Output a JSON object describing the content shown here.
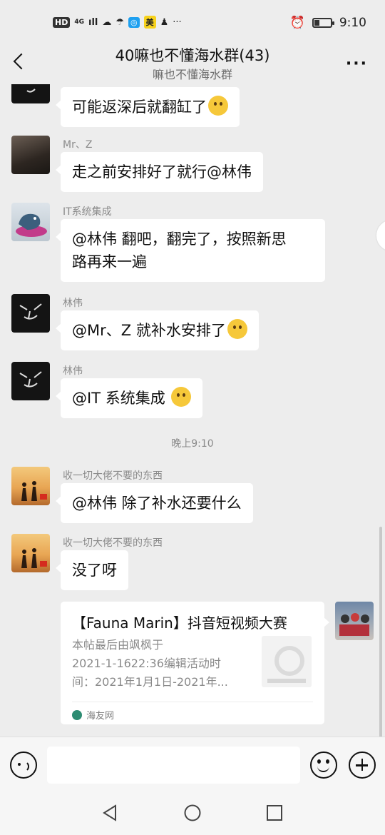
{
  "status_bar": {
    "hd": "HD",
    "network": "4G",
    "signal": "ıll",
    "icons": [
      "hd-icon",
      "signal-icon",
      "cloud-icon",
      "weather-icon",
      "qq-icon",
      "meituan-icon",
      "snap-icon",
      "more-dots-icon"
    ],
    "meituan_label": "美",
    "time": "9:10"
  },
  "header": {
    "title": "40嘛也不懂海水群(43)",
    "subtitle": "嘛也不懂海水群"
  },
  "messages": [
    {
      "sender": "",
      "text": "可能返深后就翻缸了",
      "emoji": "smirk-emoji"
    },
    {
      "sender": "Mr、Z",
      "text": "走之前安排好了就行@林伟"
    },
    {
      "sender": "IT系统集成",
      "text_line1": "@林伟  翻吧，翻完了，按照新思",
      "text_line2": "路再来一遍"
    },
    {
      "sender": "林伟",
      "text": "@Mr、Z  就补水安排了",
      "emoji": "laugh-cry-emoji"
    },
    {
      "sender": "林伟",
      "text": "@IT 系统集成 ",
      "emoji": "crying-emoji"
    },
    {
      "sender": "收一切大佬不要的东西",
      "text": "@林伟  除了补水还要什么"
    },
    {
      "sender": "收一切大佬不要的东西",
      "text": "没了呀"
    }
  ],
  "time_separator": "晚上9:10",
  "link_card": {
    "title": "【Fauna Marin】抖音短视频大赛",
    "desc_line1": "本帖最后由飒枫于",
    "desc_line2": "2021-1-1622:36编辑活动时",
    "desc_line3": "间：2021年1月1日-2021年...",
    "source": "海友网"
  },
  "input": {
    "placeholder": ""
  },
  "colors": {
    "background": "#ededed",
    "bubble": "#ffffff",
    "meta_text": "#8a8a8a"
  }
}
